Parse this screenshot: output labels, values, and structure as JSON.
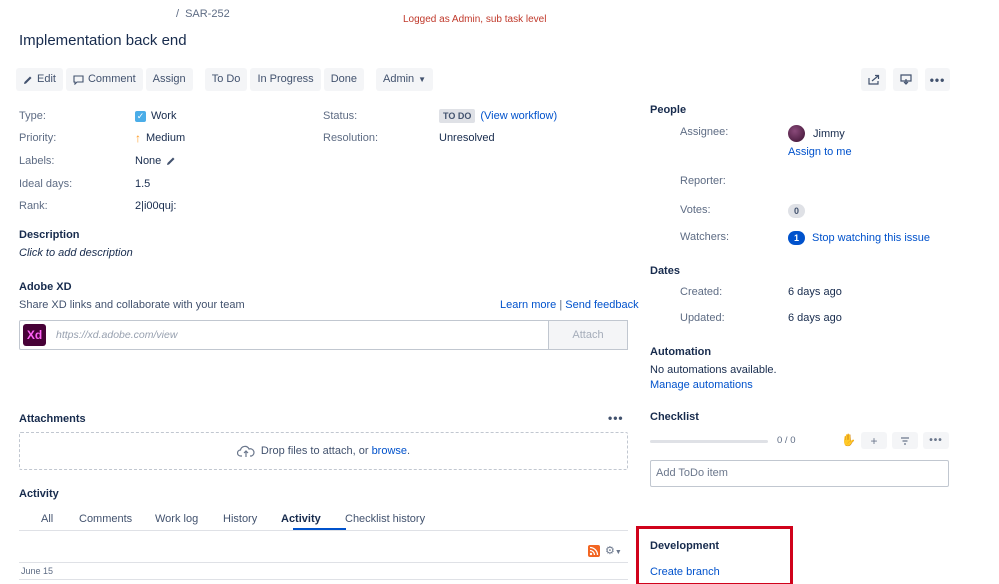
{
  "breadcrumb": {
    "separator": "/",
    "issue_key": "SAR-252"
  },
  "annotation": "Logged as Admin, sub task level",
  "page_title": "Implementation back end",
  "toolbar": {
    "edit": "Edit",
    "comment": "Comment",
    "assign": "Assign",
    "todo": "To Do",
    "in_progress": "In Progress",
    "done": "Done",
    "admin": "Admin"
  },
  "details": {
    "type_label": "Type:",
    "type_value": "Work",
    "priority_label": "Priority:",
    "priority_value": "Medium",
    "labels_label": "Labels:",
    "labels_value": "None",
    "ideal_days_label": "Ideal days:",
    "ideal_days_value": "1.5",
    "rank_label": "Rank:",
    "rank_value": "2|i00quj:",
    "status_label": "Status:",
    "status_value": "TO DO",
    "view_workflow": "(View workflow)",
    "resolution_label": "Resolution:",
    "resolution_value": "Unresolved"
  },
  "description": {
    "heading": "Description",
    "placeholder": "Click to add description"
  },
  "adobe_xd": {
    "heading": "Adobe XD",
    "subtext": "Share XD links and collaborate with your team",
    "learn_more": "Learn more",
    "divider": "|",
    "send_feedback": "Send feedback",
    "logo_text": "Xd",
    "input_placeholder": "https://xd.adobe.com/view",
    "attach": "Attach"
  },
  "attachments": {
    "heading": "Attachments",
    "drop_text": "Drop files to attach, or",
    "browse": "browse",
    "period": "."
  },
  "activity": {
    "heading": "Activity",
    "tabs": [
      "All",
      "Comments",
      "Work log",
      "History",
      "Activity",
      "Checklist history"
    ],
    "active_tab": "Activity",
    "date": "June 15"
  },
  "people": {
    "heading": "People",
    "assignee_label": "Assignee:",
    "assignee_name": "Jimmy",
    "assign_to_me": "Assign to me",
    "reporter_label": "Reporter:",
    "votes_label": "Votes:",
    "votes_count": "0",
    "watchers_label": "Watchers:",
    "watchers_count": "1",
    "stop_watching": "Stop watching this issue"
  },
  "dates": {
    "heading": "Dates",
    "created_label": "Created:",
    "created_value": "6 days ago",
    "updated_label": "Updated:",
    "updated_value": "6 days ago"
  },
  "automation": {
    "heading": "Automation",
    "status": "No automations available.",
    "manage": "Manage automations"
  },
  "checklist": {
    "heading": "Checklist",
    "progress": 0,
    "progress_text": "0 / 0",
    "add_todo_placeholder": "Add ToDo item"
  },
  "development": {
    "heading": "Development",
    "create_branch": "Create branch"
  },
  "colors": {
    "link": "#0052cc",
    "annotation": "#c0392b",
    "highlight_box": "#d0021b",
    "xd_logo_bg": "#470137",
    "xd_logo_fg": "#ff61f6"
  }
}
